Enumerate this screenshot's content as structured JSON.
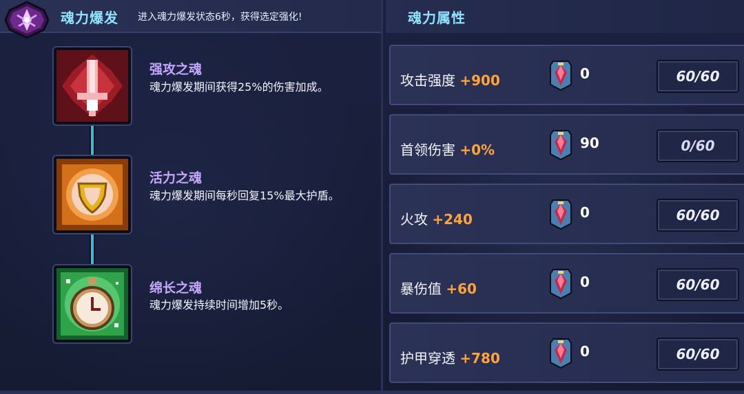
{
  "left_panel": {
    "title": "魂力爆发",
    "description": "进入魂力爆发状态6秒，获得选定强化!",
    "skills": [
      {
        "name": "强攻之魂",
        "description": "魂力爆发期间获得25%的伤害加成。",
        "icon": "red-sword-icon"
      },
      {
        "name": "活力之魂",
        "description": "魂力爆发期间每秒回复15%最大护盾。",
        "icon": "gold-shield-icon"
      },
      {
        "name": "绵长之魂",
        "description": "魂力爆发持续时间增加5秒。",
        "icon": "green-stopwatch-icon"
      }
    ]
  },
  "right_panel": {
    "title": "魂力属性",
    "attributes": [
      {
        "name": "攻击强度",
        "bonus": "+900",
        "gems": "0",
        "level": "60/60"
      },
      {
        "name": "首领伤害",
        "bonus": "+0%",
        "gems": "90",
        "level": "0/60"
      },
      {
        "name": "火攻",
        "bonus": "+240",
        "gems": "0",
        "level": "60/60"
      },
      {
        "name": "暴伤值",
        "bonus": "+60",
        "gems": "0",
        "level": "60/60"
      },
      {
        "name": "护甲穿透",
        "bonus": "+780",
        "gems": "0",
        "level": "60/60"
      }
    ]
  },
  "colors": {
    "title": "#8fe3ff",
    "skill_name": "#c6a7ff",
    "bonus": "#ffa43a",
    "background": "#151a30"
  }
}
